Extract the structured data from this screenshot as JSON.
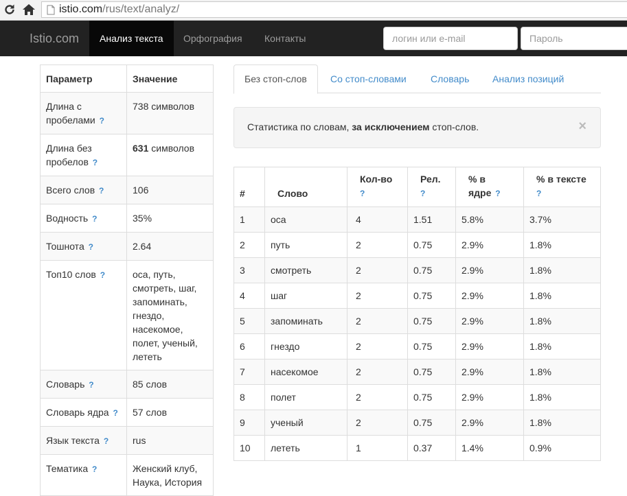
{
  "browser": {
    "url_host": "istio.com",
    "url_path": "/rus/text/analyz/"
  },
  "navbar": {
    "brand": "Istio.com",
    "items": [
      {
        "label": "Анализ текста",
        "active": true
      },
      {
        "label": "Орфография",
        "active": false
      },
      {
        "label": "Контакты",
        "active": false
      }
    ],
    "login_placeholder": "логин или e-mail",
    "password_placeholder": "Пароль"
  },
  "params": {
    "headers": [
      "Параметр",
      "Значение"
    ],
    "help_mark": "?",
    "rows": [
      {
        "name": "Длина с пробелами",
        "value": "738 символов"
      },
      {
        "name": "Длина без пробелов",
        "value_bold": "631",
        "value": " символов"
      },
      {
        "name": "Всего слов",
        "value": "106"
      },
      {
        "name": "Водность",
        "value": "35%"
      },
      {
        "name": "Тошнота",
        "value": "2.64"
      },
      {
        "name": "Топ10 слов",
        "value": "оса, путь, смотреть, шаг, запоминать, гнездо, насекомое, полет, ученый, лететь"
      },
      {
        "name": "Словарь",
        "value": "85 слов"
      },
      {
        "name": "Словарь ядра",
        "value": "57 слов"
      },
      {
        "name": "Язык текста",
        "value": "rus"
      },
      {
        "name": "Тематика",
        "value": "Женский клуб, Наука, История"
      }
    ]
  },
  "tabs": [
    {
      "label": "Без стоп-слов",
      "active": true
    },
    {
      "label": "Со стоп-словами",
      "active": false
    },
    {
      "label": "Словарь",
      "active": false
    },
    {
      "label": "Анализ позиций",
      "active": false
    }
  ],
  "alert": {
    "text_before": "Статистика по словам, ",
    "text_bold": "за исключением",
    "text_after": " стоп-слов.",
    "close": "×"
  },
  "words": {
    "headers": {
      "num": "#",
      "word": "Слово",
      "count": "Кол-во",
      "rel": "Рел.",
      "core_line1": "% в",
      "core_line2": "ядре",
      "text": "% в тексте"
    },
    "rows": [
      {
        "n": "1",
        "word": "оса",
        "count": "4",
        "rel": "1.51",
        "core": "5.8%",
        "text": "3.7%"
      },
      {
        "n": "2",
        "word": "путь",
        "count": "2",
        "rel": "0.75",
        "core": "2.9%",
        "text": "1.8%"
      },
      {
        "n": "3",
        "word": "смотреть",
        "count": "2",
        "rel": "0.75",
        "core": "2.9%",
        "text": "1.8%"
      },
      {
        "n": "4",
        "word": "шаг",
        "count": "2",
        "rel": "0.75",
        "core": "2.9%",
        "text": "1.8%"
      },
      {
        "n": "5",
        "word": "запоминать",
        "count": "2",
        "rel": "0.75",
        "core": "2.9%",
        "text": "1.8%"
      },
      {
        "n": "6",
        "word": "гнездо",
        "count": "2",
        "rel": "0.75",
        "core": "2.9%",
        "text": "1.8%"
      },
      {
        "n": "7",
        "word": "насекомое",
        "count": "2",
        "rel": "0.75",
        "core": "2.9%",
        "text": "1.8%"
      },
      {
        "n": "8",
        "word": "полет",
        "count": "2",
        "rel": "0.75",
        "core": "2.9%",
        "text": "1.8%"
      },
      {
        "n": "9",
        "word": "ученый",
        "count": "2",
        "rel": "0.75",
        "core": "2.9%",
        "text": "1.8%"
      },
      {
        "n": "10",
        "word": "лететь",
        "count": "1",
        "rel": "0.37",
        "core": "1.4%",
        "text": "0.9%"
      }
    ]
  }
}
